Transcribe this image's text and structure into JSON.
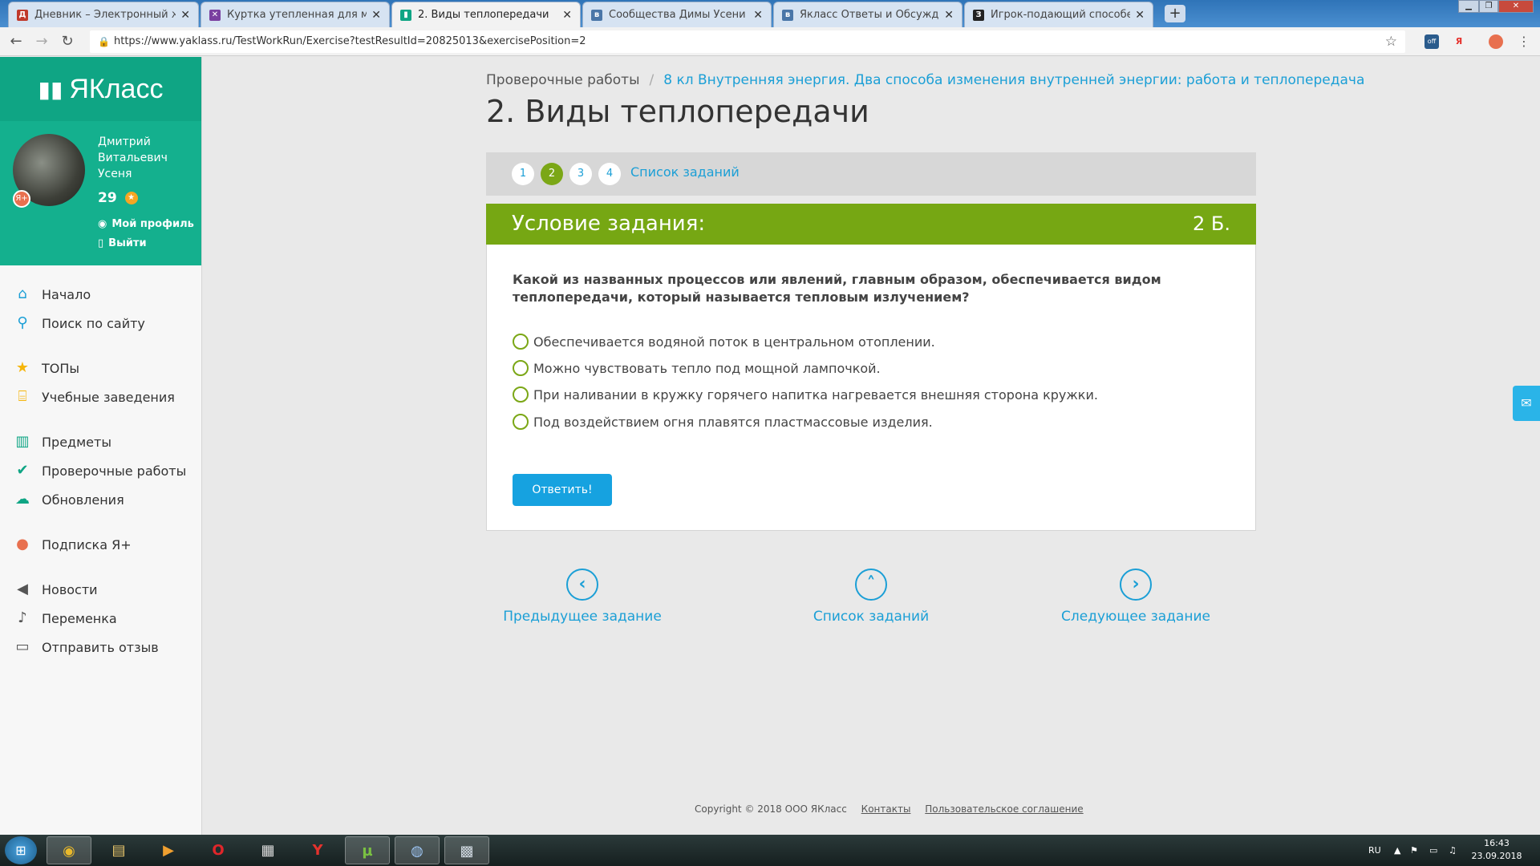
{
  "browser": {
    "tabs": [
      {
        "label": "Дневник – Электронный журн",
        "icon_color": "#c0392b",
        "icon_glyph": "Д"
      },
      {
        "label": "Куртка утепленная для мальчи",
        "icon_color": "#7a3fa0",
        "icon_glyph": "✕"
      },
      {
        "label": "2. Виды теплопередачи",
        "icon_color": "#0fa584",
        "icon_glyph": "▮"
      },
      {
        "label": "Сообщества Димы Усени",
        "icon_color": "#4a76a8",
        "icon_glyph": "в"
      },
      {
        "label": "Якласс Ответы и Обсуждения",
        "icon_color": "#4a76a8",
        "icon_glyph": "в"
      },
      {
        "label": "Игрок-подающий способен вы",
        "icon_color": "#222",
        "icon_glyph": "З"
      }
    ],
    "url": "https://www.yaklass.ru/TestWorkRun/Exercise?testResultId=20825013&exercisePosition=2",
    "ext_off_label": "off",
    "ext_ya_label": "Я"
  },
  "sidebar": {
    "logo_text": "ЯКласс",
    "user": {
      "name": "Дмитрий Витальевич Усеня",
      "score": "29",
      "profile_label": "Мой профиль",
      "logout_label": "Выйти",
      "badge": "Я+"
    },
    "menu": [
      {
        "label": "Начало",
        "icon": "home-icon",
        "glyph": "⌂",
        "color": "#1b9fd6"
      },
      {
        "label": "Поиск по сайту",
        "icon": "search-icon",
        "glyph": "⚲",
        "color": "#1b9fd6"
      },
      {
        "label": "ТОПы",
        "icon": "star-icon",
        "glyph": "★",
        "color": "#f5b50a"
      },
      {
        "label": "Учебные заведения",
        "icon": "school-icon",
        "glyph": "⌸",
        "color": "#f5b50a"
      },
      {
        "label": "Предметы",
        "icon": "books-icon",
        "glyph": "▥",
        "color": "#0fa584"
      },
      {
        "label": "Проверочные работы",
        "icon": "check-circle-icon",
        "glyph": "✔",
        "color": "#0fa584"
      },
      {
        "label": "Обновления",
        "icon": "cloud-icon",
        "glyph": "☁",
        "color": "#0fa584"
      },
      {
        "label": "Подписка Я+",
        "icon": "subscription-icon",
        "glyph": "●",
        "color": "#e8704f"
      },
      {
        "label": "Новости",
        "icon": "megaphone-icon",
        "glyph": "◀",
        "color": "#555"
      },
      {
        "label": "Переменка",
        "icon": "bell-icon",
        "glyph": "♪",
        "color": "#555"
      },
      {
        "label": "Отправить отзыв",
        "icon": "comment-icon",
        "glyph": "▭",
        "color": "#555"
      }
    ]
  },
  "breadcrumb": {
    "root": "Проверочные работы",
    "current": "8 кл Внутренняя энергия. Два способа изменения внутренней энергии: работа и теплопередача"
  },
  "page_title": "2. Виды теплопередачи",
  "steps": {
    "items": [
      "1",
      "2",
      "3",
      "4"
    ],
    "current": "2",
    "list_link": "Список заданий"
  },
  "task": {
    "header": "Условие задания:",
    "points": "2 Б.",
    "question": "Какой из названных процессов или явлений, главным образом, обеспечивается видом теплопередачи, который называется тепловым излучением?",
    "options": [
      "Обеспечивается водяной поток в центральном отоплении.",
      "Можно чувствовать тепло под мощной лампочкой.",
      "При наливании в кружку горячего напитка нагревается внешняя сторона кружки.",
      "Под воздействием огня плавятся пластмассовые изделия."
    ],
    "answer_button": "Ответить!"
  },
  "pager": {
    "prev": "Предыдущее задание",
    "list": "Список заданий",
    "next": "Следующее задание"
  },
  "footer": {
    "copyright": "Copyright © 2018 ООО ЯКласс",
    "contacts": "Контакты",
    "agreement": "Пользовательское соглашение"
  },
  "taskbar": {
    "lang": "RU",
    "time": "16:43",
    "date": "23.09.2018"
  }
}
